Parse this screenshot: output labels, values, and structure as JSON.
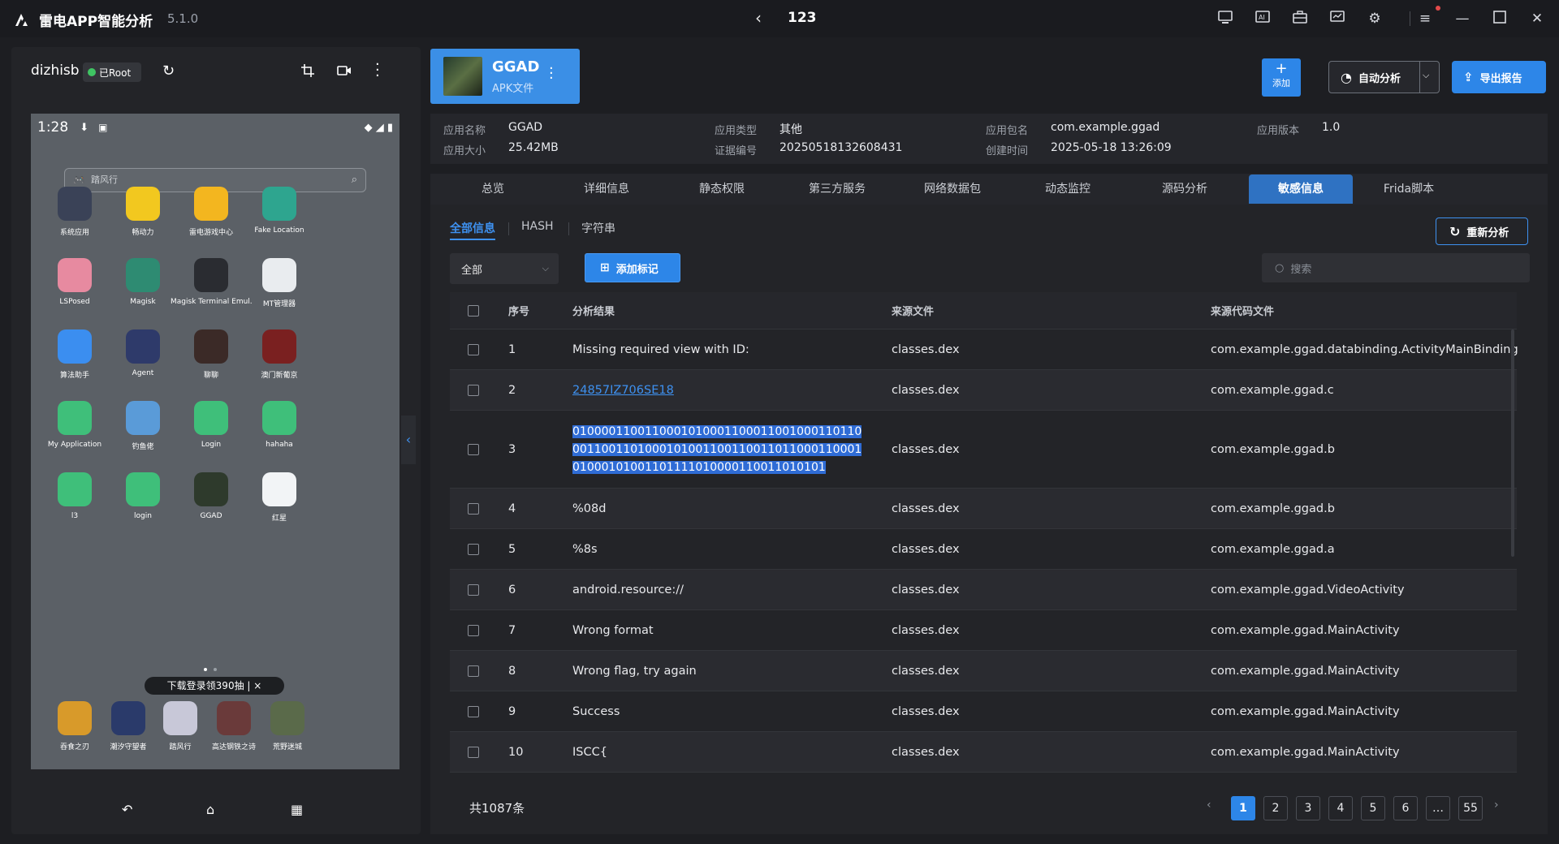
{
  "titlebar": {
    "app_name": "雷电APP智能分析",
    "version": "5.1.0",
    "nav_title": "123",
    "icons": [
      "screen-cast-icon",
      "ai-icon",
      "toolbox-icon",
      "monitor-icon",
      "settings-icon",
      "menu-icon",
      "minimize-icon",
      "maximize-icon",
      "close-icon"
    ]
  },
  "device": {
    "name": "dizhisb",
    "root_label": "已Root",
    "status_time": "1:28",
    "search_placeholder": "踏风行",
    "apps": [
      {
        "label": "系统应用",
        "color": "#3a4257"
      },
      {
        "label": "畅动力",
        "color": "#f2c81f"
      },
      {
        "label": "雷电游戏中心",
        "color": "#f3b61f"
      },
      {
        "label": "Fake Location",
        "color": "#2ea58f"
      },
      {
        "label": "LSPosed",
        "color": "#e78aa0"
      },
      {
        "label": "Magisk",
        "color": "#2e8b72"
      },
      {
        "label": "Magisk Terminal Emul...",
        "color": "#2a2c31"
      },
      {
        "label": "MT管理器",
        "color": "#e9ecef"
      },
      {
        "label": "算法助手",
        "color": "#3b8ef0"
      },
      {
        "label": "Agent",
        "color": "#2e3a6a"
      },
      {
        "label": "聊聊",
        "color": "#3b2a27"
      },
      {
        "label": "澳门新葡京",
        "color": "#7a2020"
      },
      {
        "label": "My Application",
        "color": "#3fbf7a"
      },
      {
        "label": "钓鱼佬",
        "color": "#5a9bd8"
      },
      {
        "label": "Login",
        "color": "#3fbf7a"
      },
      {
        "label": "hahaha",
        "color": "#3fbf7a"
      },
      {
        "label": "l3",
        "color": "#3fbf7a"
      },
      {
        "label": "login",
        "color": "#3fbf7a"
      },
      {
        "label": "GGAD",
        "color": "#2e3a2c"
      },
      {
        "label": "红星",
        "color": "#f2f4f6"
      }
    ],
    "promo": "下载登录领390抽  |  ×",
    "dock": [
      "吞食之刃",
      "潮汐守望者",
      "踏风行",
      "高达钢铁之诗",
      "荒野迷城"
    ]
  },
  "app_card": {
    "name": "GGAD",
    "type": "APK文件"
  },
  "actions": {
    "add": "添加",
    "auto": "自动分析",
    "export": "导出报告"
  },
  "info": {
    "name_k": "应用名称",
    "name_v": "GGAD",
    "size_k": "应用大小",
    "size_v": "25.42MB",
    "type_k": "应用类型",
    "type_v": "其他",
    "cert_k": "证据编号",
    "cert_v": "20250518132608431",
    "pkg_k": "应用包名",
    "pkg_v": "com.example.ggad",
    "time_k": "创建时间",
    "time_v": "2025-05-18 13:26:09",
    "ver_k": "应用版本",
    "ver_v": "1.0"
  },
  "tabs": [
    "总览",
    "详细信息",
    "静态权限",
    "第三方服务",
    "网络数据包",
    "动态监控",
    "源码分析",
    "敏感信息",
    "Frida脚本"
  ],
  "active_tab": "敏感信息",
  "subtabs": [
    "全部信息",
    "HASH",
    "字符串"
  ],
  "reanalyze": "重新分析",
  "filter": {
    "value": "全部",
    "mark_btn": "添加标记",
    "search_placeholder": "搜索"
  },
  "table": {
    "headers": {
      "no": "序号",
      "result": "分析结果",
      "src": "来源文件",
      "code": "来源代码文件"
    },
    "rows": [
      {
        "no": "1",
        "result": "Missing required view with ID:",
        "src": "classes.dex",
        "code": "com.example.ggad.databinding.ActivityMainBinding"
      },
      {
        "no": "2",
        "result": "24857IZ706SE18",
        "src": "classes.dex",
        "code": "com.example.ggad.c"
      },
      {
        "no": "3",
        "result": "0100001100110001010001100011001000110110001100110100010100110011001101100011000101000101001101111010000110011010101",
        "src": "classes.dex",
        "code": "com.example.ggad.b"
      },
      {
        "no": "4",
        "result": "%08d",
        "src": "classes.dex",
        "code": "com.example.ggad.b"
      },
      {
        "no": "5",
        "result": "%8s",
        "src": "classes.dex",
        "code": "com.example.ggad.a"
      },
      {
        "no": "6",
        "result": "android.resource://",
        "src": "classes.dex",
        "code": "com.example.ggad.VideoActivity"
      },
      {
        "no": "7",
        "result": "Wrong format",
        "src": "classes.dex",
        "code": "com.example.ggad.MainActivity"
      },
      {
        "no": "8",
        "result": "Wrong flag, try again",
        "src": "classes.dex",
        "code": "com.example.ggad.MainActivity"
      },
      {
        "no": "9",
        "result": "Success",
        "src": "classes.dex",
        "code": "com.example.ggad.MainActivity"
      },
      {
        "no": "10",
        "result": "ISCC{",
        "src": "classes.dex",
        "code": "com.example.ggad.MainActivity"
      }
    ]
  },
  "pagination": {
    "total": "共1087条",
    "pages": [
      "1",
      "2",
      "3",
      "4",
      "5",
      "6",
      "…",
      "55"
    ],
    "current": "1"
  }
}
